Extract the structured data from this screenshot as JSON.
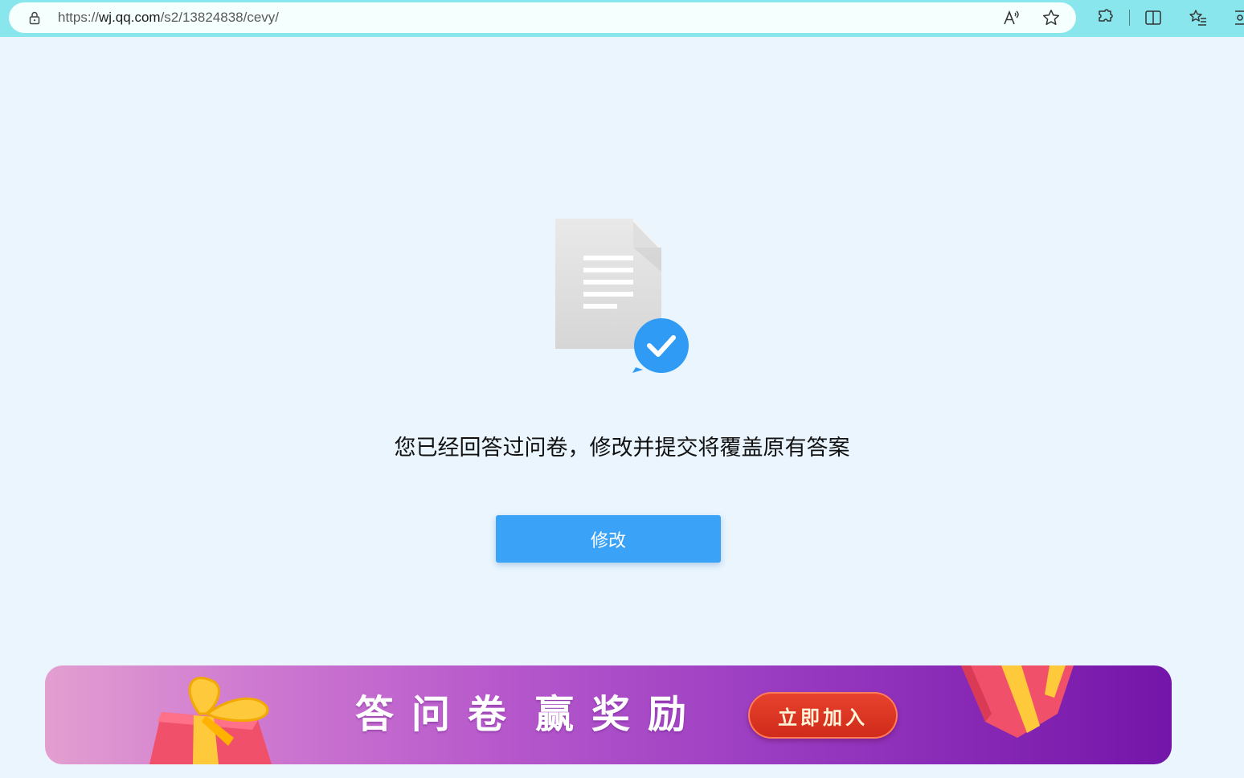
{
  "browser": {
    "url_prefix": "https://",
    "url_host": "wj.qq.com",
    "url_path": "/s2/13824838/cevy/",
    "icons": [
      "lock-icon",
      "read-aloud-icon",
      "favorite-star-icon",
      "extensions-icon",
      "split-screen-icon",
      "favorites-icon",
      "copilot-icon"
    ],
    "read_aloud_glyph": "A⁾"
  },
  "main": {
    "message": "您已经回答过问卷，修改并提交将覆盖原有答案",
    "modify_button": "修改"
  },
  "banner": {
    "title_part1": "答问卷",
    "title_part2": "赢奖励",
    "join_button": "立即加入"
  },
  "colors": {
    "browser_bar": "#89e6ec",
    "page_background": "#eaf5fe",
    "primary_button": "#3aa3f7",
    "check_badge": "#2f9bf4",
    "banner_start": "#e39fd0",
    "banner_end": "#7415a9",
    "join_button": "#d9331f"
  }
}
